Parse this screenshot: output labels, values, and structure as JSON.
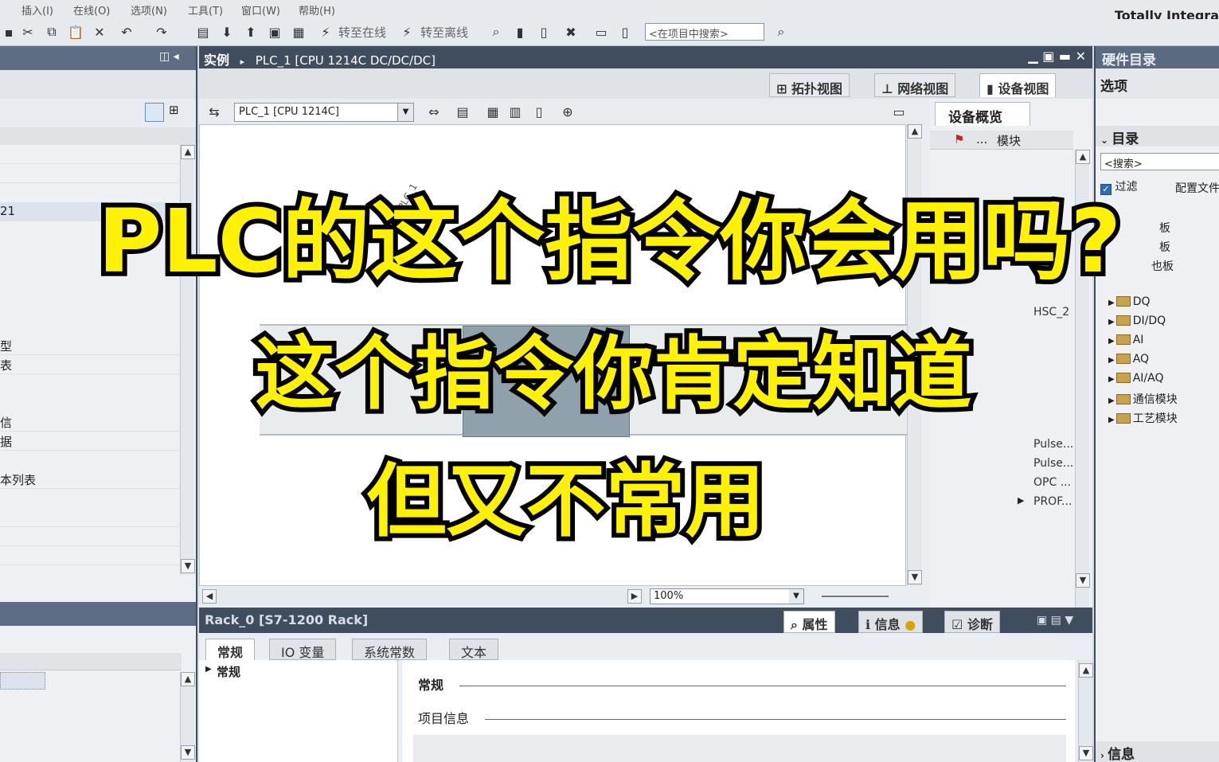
{
  "app": {
    "title": "Totally Integra"
  },
  "menu": [
    "插入(I)",
    "在线(O)",
    "选项(N)",
    "工具(T)",
    "窗口(W)",
    "帮助(H)"
  ],
  "toolbar": {
    "go_online": "转至在线",
    "go_offline": "转至离线",
    "search_placeholder": "<在项目中搜索>"
  },
  "center": {
    "breadcrumb_root": "实例",
    "breadcrumb_device": "PLC_1 [CPU 1214C DC/DC/DC]",
    "tabs": {
      "topology": "拓扑视图",
      "network": "网络视图",
      "device": "设备视图"
    },
    "device_select": "PLC_1 [CPU 1214C]",
    "plc_label": "PLC_1",
    "zoom": "100%"
  },
  "overview": {
    "title": "设备概览",
    "col_module": "模块",
    "col_dots": "...",
    "rows": [
      "HSC_2",
      "Pulse...",
      "Pulse...",
      "OPC ...",
      "PROF..."
    ]
  },
  "catalog": {
    "title": "硬件目录",
    "options": "选项",
    "directory": "目录",
    "search": "<搜索>",
    "filter": "过滤",
    "profile": "配置文件",
    "partial_items": [
      "板",
      "板",
      "也板"
    ],
    "items": [
      "DQ",
      "DI/DQ",
      "AI",
      "AQ",
      "AI/AQ",
      "通信模块",
      "工艺模块"
    ],
    "info": "信息"
  },
  "left": {
    "partial_items": [
      "21",
      "型",
      "表",
      "信",
      "据",
      "本列表"
    ]
  },
  "inspector": {
    "title": "Rack_0 [S7-1200 Rack]",
    "tabs": {
      "properties": "属性",
      "info": "信息",
      "diagnostics": "诊断"
    },
    "subtabs": [
      "常规",
      "IO 变量",
      "系统常数",
      "文本"
    ],
    "nav_item": "常规",
    "section_general": "常规",
    "section_project_info": "项目信息"
  },
  "overlay": {
    "line1": "PLC的这个指令你会用吗?",
    "line2": "这个指令你肯定知道",
    "line3": "但又不常用"
  },
  "colors": {
    "caption_fill": "#fff200",
    "caption_stroke": "#000000",
    "title_bar": "#3f4d5e"
  }
}
